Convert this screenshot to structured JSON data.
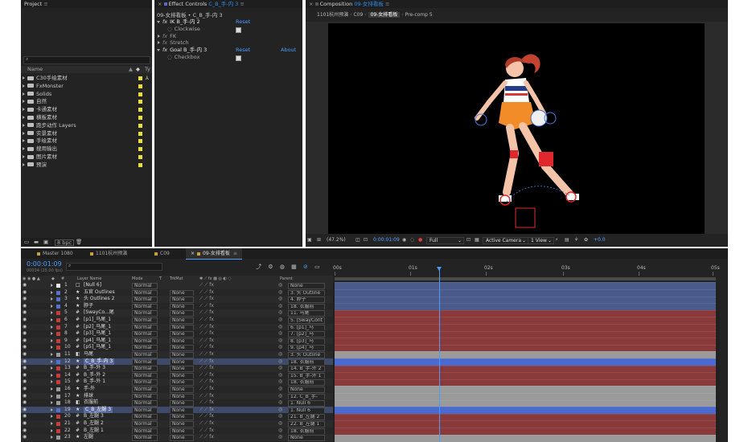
{
  "project": {
    "title": "Project",
    "col_name": "Name",
    "col_type": "Ty",
    "bpc": "8 bpc",
    "items": [
      {
        "label": "C30手绘素材",
        "color": "#e8e03a",
        "swatch": "#e8e03a",
        "type": "icon"
      },
      {
        "label": "FxMonster",
        "color": "#e8e03a",
        "swatch": "#e8e03a",
        "type": ""
      },
      {
        "label": "Solids",
        "color": "#e8e03a",
        "swatch": "#e8e03a",
        "type": ""
      },
      {
        "label": "自然",
        "color": "#e8e03a",
        "swatch": "#e8e03a",
        "type": ""
      },
      {
        "label": "卡通素材",
        "color": "#e8e03a",
        "swatch": "#e8e03a",
        "type": ""
      },
      {
        "label": "横板素材",
        "color": "#e8e03a",
        "swatch": "#e8e03a",
        "type": ""
      },
      {
        "label": "跑步动作 Layers",
        "color": "#e8e03a",
        "swatch": "#e8e03a",
        "type": ""
      },
      {
        "label": "实景素材",
        "color": "#e8e03a",
        "swatch": "#e8e03a",
        "type": ""
      },
      {
        "label": "手绘素材",
        "color": "#e8e03a",
        "swatch": "#e8e03a",
        "type": ""
      },
      {
        "label": "搜用输出",
        "color": "#e8e03a",
        "swatch": "#e8e03a",
        "type": ""
      },
      {
        "label": "图片素材",
        "color": "#e8e03a",
        "swatch": "#e8e03a",
        "type": ""
      },
      {
        "label": "预演",
        "color": "#e8e03a",
        "swatch": "#e8e03a",
        "type": ""
      }
    ]
  },
  "effect_controls": {
    "title_prefix": "Effect Controls",
    "title_layer": "C_B_手-内 3",
    "breadcrumb": "09-女排看板 • C_B_手-内 3",
    "effects": [
      {
        "fx": "fx",
        "name": "IK B_手-内 2",
        "reset": "Reset",
        "about": ""
      },
      {
        "fx": "",
        "name": "Clockwise",
        "reset": "",
        "about": "",
        "checkbox": true,
        "indent": true
      },
      {
        "fx": "fx",
        "name": "FK",
        "reset": "",
        "about": "",
        "plain": true
      },
      {
        "fx": "fx",
        "name": "Stretch",
        "reset": "",
        "about": "",
        "plain": true
      },
      {
        "fx": "fx",
        "name": "Goal B_手-内 3",
        "reset": "Reset",
        "about": "About"
      },
      {
        "fx": "",
        "name": "Checkbox",
        "reset": "",
        "about": "",
        "checkbox": true,
        "indent": true
      }
    ]
  },
  "composition": {
    "title_prefix": "Composition",
    "title_name": "09-女排看板",
    "crumbs": [
      "1101杭州预演",
      "C09",
      "09-女排看板",
      "Pre-comp 5"
    ],
    "footer": {
      "zoom": "(47.2%)",
      "timecode": "0:00:01:09",
      "resolution": "Full",
      "camera": "Active Camera",
      "views": "1 View",
      "exposure": "+0.0"
    }
  },
  "timeline": {
    "tabs": [
      "Master 1080",
      "1101杭州预演",
      "C09",
      "09-女排看板"
    ],
    "timecode": "0:00:01:09",
    "timecode_sub": "00034 (25.00 fps)",
    "ruler": [
      "00s",
      "01s",
      "02s",
      "03s",
      "04s",
      "05s"
    ],
    "headers": {
      "num": "#",
      "name": "Layer Name",
      "mode": "Mode",
      "trkmat": "TrkMat",
      "parent": "Parent"
    },
    "layers": [
      {
        "n": "1",
        "label": "#e8e8e8",
        "icon": "□",
        "name": "[Null 6]",
        "mode": "Normal",
        "trk": "",
        "parent": "None",
        "bar": "#4a5a8a"
      },
      {
        "n": "2",
        "label": "#5770c8",
        "icon": "★",
        "name": "五官 Outlines",
        "mode": "Normal",
        "trk": "None",
        "parent": "3. 头 Outline",
        "bar": "#4a5a8a"
      },
      {
        "n": "3",
        "label": "#5770c8",
        "icon": "★",
        "name": "头 Outlines 2",
        "mode": "Normal",
        "trk": "None",
        "parent": "4. 脖子",
        "bar": "#4a5a8a"
      },
      {
        "n": "4",
        "label": "#5770c8",
        "icon": "★",
        "name": "脖子",
        "mode": "Normal",
        "trk": "None",
        "parent": "18. 衣服前",
        "bar": "#4a5a8a"
      },
      {
        "n": "5",
        "label": "#c83c3c",
        "icon": "#",
        "name": "[SwayCo...尾",
        "mode": "Normal",
        "trk": "None",
        "parent": "11. 马尾",
        "bar": "#8a3a3a"
      },
      {
        "n": "6",
        "label": "#c83c3c",
        "icon": "#",
        "name": "[p1]_马尾_1",
        "mode": "Normal",
        "trk": "None",
        "parent": "5. [SwayCont",
        "bar": "#8a3a3a"
      },
      {
        "n": "7",
        "label": "#c83c3c",
        "icon": "#",
        "name": "[p2]_马尾_1",
        "mode": "Normal",
        "trk": "None",
        "parent": "6. [p1]_马",
        "bar": "#8a3a3a"
      },
      {
        "n": "8",
        "label": "#c83c3c",
        "icon": "#",
        "name": "[p3]_马尾_1",
        "mode": "Normal",
        "trk": "None",
        "parent": "7. [p2]_马",
        "bar": "#8a3a3a"
      },
      {
        "n": "9",
        "label": "#c83c3c",
        "icon": "#",
        "name": "[p4]_马尾_1",
        "mode": "Normal",
        "trk": "None",
        "parent": "8. [p3]_马",
        "bar": "#8a3a3a"
      },
      {
        "n": "10",
        "label": "#c83c3c",
        "icon": "#",
        "name": "[p5]_马尾_1",
        "mode": "Normal",
        "trk": "None",
        "parent": "9. [p4]_马",
        "bar": "#8a3a3a"
      },
      {
        "n": "11",
        "label": "#9a9a9a",
        "icon": "◧",
        "name": "马尾",
        "mode": "Normal",
        "trk": "None",
        "parent": "3. 头 Outline",
        "bar": "#9a9a9a"
      },
      {
        "n": "12",
        "label": "#5770c8",
        "icon": "★",
        "name": "C_B_手-内 3",
        "mode": "Normal",
        "trk": "None",
        "parent": "18. 衣服前",
        "bar": "#4a6ad0",
        "selected": true
      },
      {
        "n": "13",
        "label": "#c83c3c",
        "icon": "#",
        "name": "B_手-外 3",
        "mode": "Normal",
        "trk": "None",
        "parent": "14. B_手-外 2",
        "bar": "#8a3a3a"
      },
      {
        "n": "14",
        "label": "#c83c3c",
        "icon": "#",
        "name": "B_手-外 2",
        "mode": "Normal",
        "trk": "None",
        "parent": "15. B_手-外 1",
        "bar": "#8a3a3a"
      },
      {
        "n": "15",
        "label": "#c83c3c",
        "icon": "#",
        "name": "B_手-外 1",
        "mode": "Normal",
        "trk": "None",
        "parent": "18. 衣服前",
        "bar": "#8a3a3a"
      },
      {
        "n": "16",
        "label": "#9a9a9a",
        "icon": "★",
        "name": "手-外",
        "mode": "Normal",
        "trk": "None",
        "parent": "None",
        "bar": "#9a9a9a"
      },
      {
        "n": "17",
        "label": "#9a9a9a",
        "icon": "★",
        "name": "排球",
        "mode": "Normal",
        "trk": "None",
        "parent": "12. C_B_手-",
        "bar": "#9a9a9a"
      },
      {
        "n": "18",
        "label": "#9a9a9a",
        "icon": "◧",
        "name": "衣服前",
        "mode": "Normal",
        "trk": "None",
        "parent": "1. Null 6",
        "bar": "#9a9a9a"
      },
      {
        "n": "19",
        "label": "#5770c8",
        "icon": "★",
        "name": "C_B_左腿 3",
        "mode": "Normal",
        "trk": "None",
        "parent": "1. Null 6",
        "bar": "#4a6ad0",
        "selected": true
      },
      {
        "n": "20",
        "label": "#c83c3c",
        "icon": "#",
        "name": "B_左腿 3",
        "mode": "Normal",
        "trk": "None",
        "parent": "21. B_左腿 2",
        "bar": "#8a3a3a"
      },
      {
        "n": "21",
        "label": "#c83c3c",
        "icon": "#",
        "name": "B_左腿 2",
        "mode": "Normal",
        "trk": "None",
        "parent": "22. B_左腿 1",
        "bar": "#8a3a3a"
      },
      {
        "n": "22",
        "label": "#c83c3c",
        "icon": "#",
        "name": "B_左腿 1",
        "mode": "Normal",
        "trk": "None",
        "parent": "18. 衣服前",
        "bar": "#8a3a3a"
      },
      {
        "n": "23",
        "label": "#9a9a9a",
        "icon": "★",
        "name": "左腿",
        "mode": "Normal",
        "trk": "None",
        "parent": "None",
        "bar": "#9a9a9a"
      }
    ]
  }
}
